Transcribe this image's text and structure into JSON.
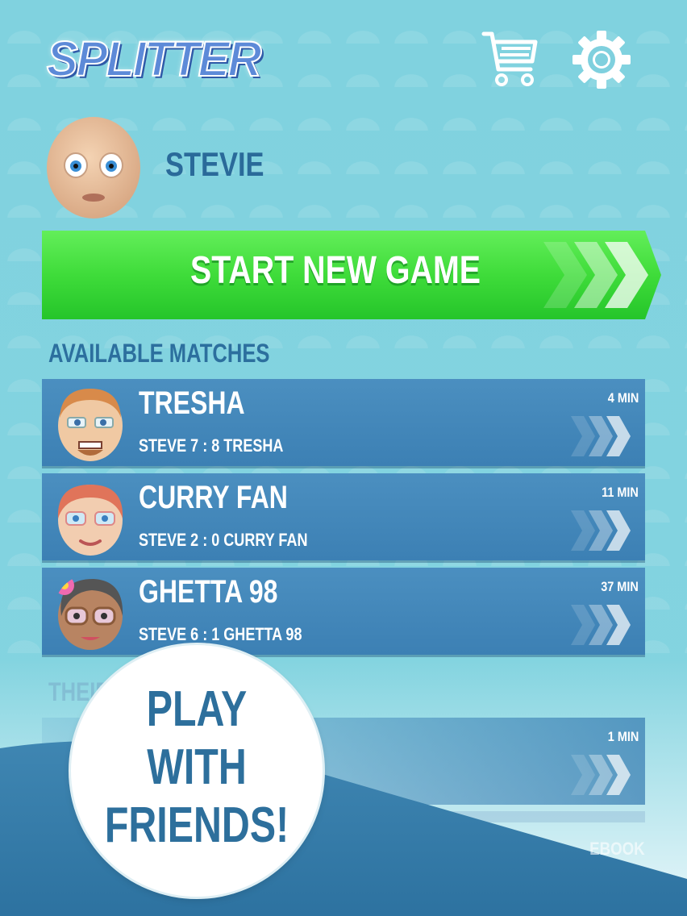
{
  "app": {
    "logo": "SPLITTER"
  },
  "header": {
    "cart_icon": "shopping-cart-icon",
    "settings_icon": "gear-icon"
  },
  "profile": {
    "username": "STEVIE"
  },
  "start_button": {
    "label": "START NEW GAME"
  },
  "available_matches": {
    "title": "AVAILABLE MATCHES",
    "items": [
      {
        "name": "TRESHA",
        "score": "STEVE  7 : 8  TRESHA",
        "time": "4 MIN"
      },
      {
        "name": "CURRY FAN",
        "score": "STEVE   2 : 0  CURRY FAN",
        "time": "11 MIN"
      },
      {
        "name": "GHETTA 98",
        "score": "STEVE  6 : 1 GHETTA 98",
        "time": "37 MIN"
      }
    ]
  },
  "their_turn": {
    "title": "THEIR",
    "items": [
      {
        "time": "1 MIN"
      }
    ],
    "facebook_text": "EBOOK"
  },
  "promo": {
    "badge": "PLAY WITH FRIENDS!"
  },
  "colors": {
    "green": "#3ddc3a",
    "blue_row": "#4389bd",
    "title_blue": "#2c6f9e"
  }
}
